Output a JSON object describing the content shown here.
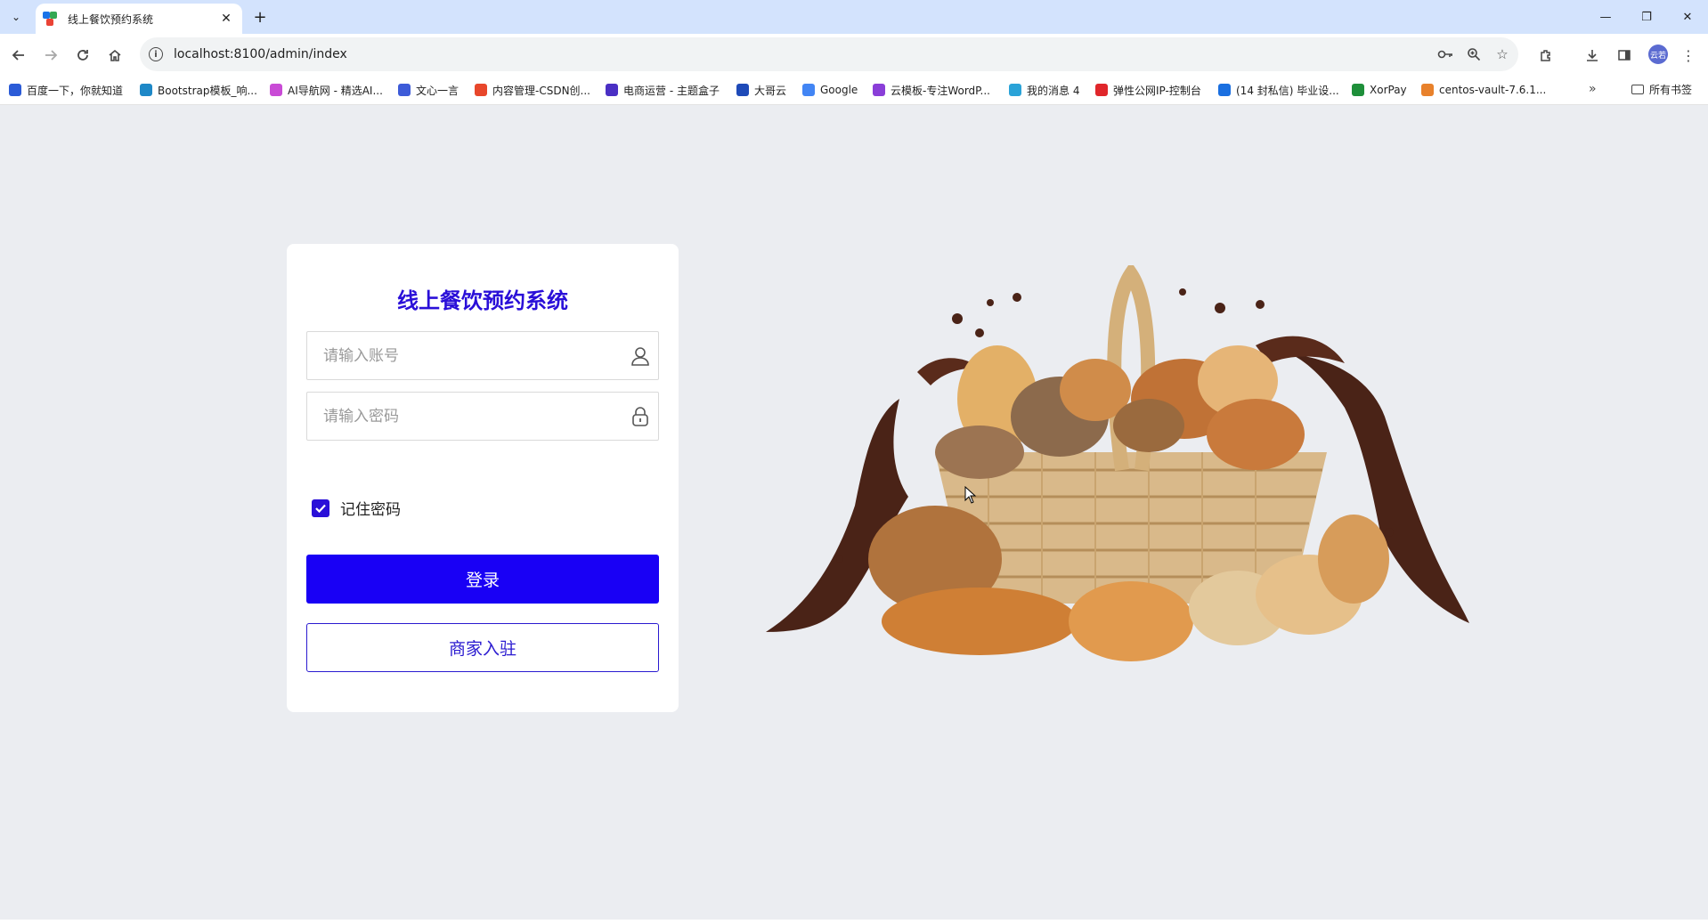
{
  "browser": {
    "tab_title": "线上餐饮预约系统",
    "url": "localhost:8100/admin/index",
    "profile_label": "云若",
    "bookmarks": [
      {
        "label": "百度一下，你就知道",
        "color": "#2b5bd7"
      },
      {
        "label": "Bootstrap模板_响...",
        "color": "#1e88c7"
      },
      {
        "label": "AI导航网 - 精选AI...",
        "color": "#c94bd6"
      },
      {
        "label": "文心一言",
        "color": "#3d5bd8"
      },
      {
        "label": "内容管理-CSDN创...",
        "color": "#e8472b"
      },
      {
        "label": "电商运营 - 主题盒子",
        "color": "#4a2fc4"
      },
      {
        "label": "大哥云",
        "color": "#1e4ab8"
      },
      {
        "label": "Google",
        "color": "#4285f4"
      },
      {
        "label": "云模板-专注WordP...",
        "color": "#8a3ed8"
      },
      {
        "label": "我的消息 4",
        "color": "#2aa3d8"
      },
      {
        "label": "弹性公网IP-控制台",
        "color": "#e0262b"
      },
      {
        "label": "(14 封私信) 毕业设...",
        "color": "#1a6fe0"
      },
      {
        "label": "XorPay",
        "color": "#1e8f3a"
      },
      {
        "label": "centos-vault-7.6.1...",
        "color": "#e8812b"
      }
    ],
    "all_bookmarks_label": "所有书签"
  },
  "login": {
    "title": "线上餐饮预约系统",
    "account_placeholder": "请输入账号",
    "password_placeholder": "请输入密码",
    "remember_label": "记住密码",
    "remember_checked": true,
    "login_button": "登录",
    "merchant_button": "商家入驻"
  },
  "colors": {
    "accent": "#1900f5",
    "title": "#2a0fd8",
    "page_background": "#ebedf1"
  }
}
